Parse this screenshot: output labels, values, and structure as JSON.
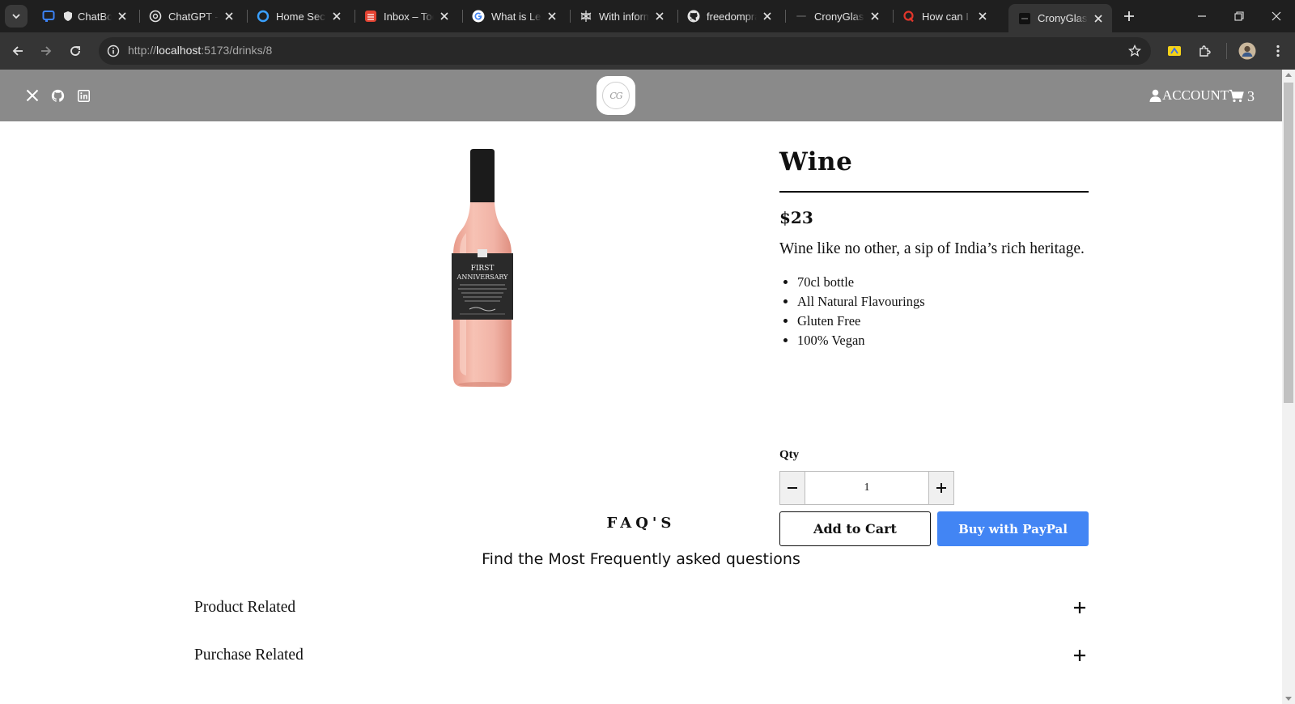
{
  "browser": {
    "tabs": [
      {
        "title": "ChatBot",
        "favicon": "chatbot-icon"
      },
      {
        "title": "ChatGPT - S",
        "favicon": "openai-icon"
      },
      {
        "title": "Home Secur",
        "favicon": "ring-icon"
      },
      {
        "title": "Inbox – Tod",
        "favicon": "todoist-icon"
      },
      {
        "title": "What is Len",
        "favicon": "google-icon"
      },
      {
        "title": "With inform",
        "favicon": "perplexity-icon"
      },
      {
        "title": "freedompra",
        "favicon": "github-icon"
      },
      {
        "title": "CronyGlass",
        "favicon": "crony-icon"
      },
      {
        "title": "How can I s",
        "favicon": "quora-icon"
      },
      {
        "title": "CronyGlass",
        "favicon": "crony-icon",
        "active": true
      }
    ],
    "url": {
      "prefix": "http://",
      "host": "localhost",
      "path": ":5173/drinks/8"
    }
  },
  "header": {
    "social": [
      "x-icon",
      "github-icon",
      "linkedin-icon"
    ],
    "logo_text": "CG",
    "account_label": "ACCOUNT",
    "cart_count": "3"
  },
  "product": {
    "image_label_line1": "FIRST",
    "image_label_line2": "ANNIVERSARY",
    "title": "Wine",
    "price": "$23",
    "description": "Wine like no other, a sip of India’s rich heritage.",
    "features": [
      "70cl bottle",
      "All Natural Flavourings",
      "Gluten Free",
      "100% Vegan"
    ],
    "qty_label": "Qty",
    "qty_value": "1",
    "add_to_cart_label": "Add to Cart",
    "paypal_label": "Buy with PayPal"
  },
  "faq": {
    "heading": "FAQ'S",
    "subheading": "Find the Most Frequently asked questions",
    "sections": [
      "Product Related",
      "Purchase Related"
    ]
  },
  "colors": {
    "header_bg": "#8a8a8a",
    "paypal_blue": "#4285f4",
    "wine_rose": "#f1b3a6"
  }
}
